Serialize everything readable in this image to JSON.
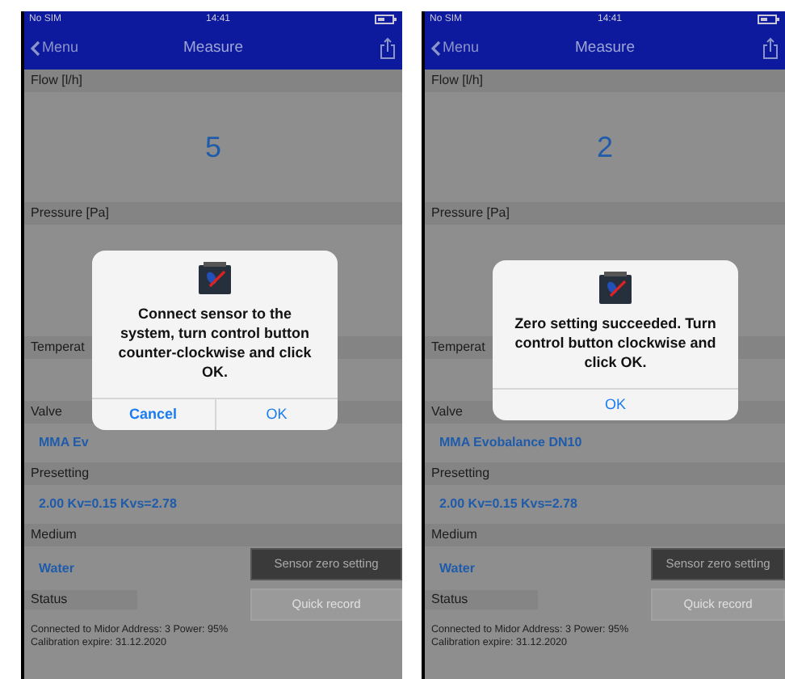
{
  "phones": [
    {
      "status_bar": {
        "carrier": "No SIM",
        "time": "14:41"
      },
      "nav": {
        "back": "Menu",
        "title": "Measure"
      },
      "flow": {
        "label": "Flow [l/h]",
        "value": "5"
      },
      "pressure": {
        "label": "Pressure [Pa]"
      },
      "temperature": {
        "label": "Temperat"
      },
      "valve": {
        "label": "Valve",
        "value": "MMA Ev"
      },
      "presetting": {
        "label": "Presetting",
        "value": "2.00 Kv=0.15 Kvs=2.78"
      },
      "medium": {
        "label": "Medium",
        "value": "Water"
      },
      "buttons": [
        {
          "label": "Sensor zero setting",
          "disabled": false
        },
        {
          "label": "Quick record",
          "disabled": true
        }
      ],
      "status": {
        "label": "Status",
        "text": "Connected to Midor Address: 3 Power: 95% Calibration expire: 31.12.2020"
      },
      "dialog": {
        "message": "Connect sensor to the system, turn control button counter-clockwise and click OK.",
        "actions": [
          "Cancel",
          "OK"
        ]
      }
    },
    {
      "status_bar": {
        "carrier": "No SIM",
        "time": "14:41"
      },
      "nav": {
        "back": "Menu",
        "title": "Measure"
      },
      "flow": {
        "label": "Flow [l/h]",
        "value": "2"
      },
      "pressure": {
        "label": "Pressure [Pa]"
      },
      "temperature": {
        "label": "Temperat"
      },
      "valve": {
        "label": "Valve",
        "value": "MMA Evobalance DN10"
      },
      "presetting": {
        "label": "Presetting",
        "value": "2.00 Kv=0.15 Kvs=2.78"
      },
      "medium": {
        "label": "Medium",
        "value": "Water"
      },
      "buttons": [
        {
          "label": "Sensor zero setting",
          "disabled": false
        },
        {
          "label": "Quick record",
          "disabled": true
        }
      ],
      "status": {
        "label": "Status",
        "text": "Connected to Midor Address: 3 Power: 95% Calibration expire: 31.12.2020"
      },
      "dialog": {
        "message": "Zero setting succeeded. Turn control button clockwise and click OK.",
        "actions": [
          "OK"
        ]
      }
    }
  ]
}
